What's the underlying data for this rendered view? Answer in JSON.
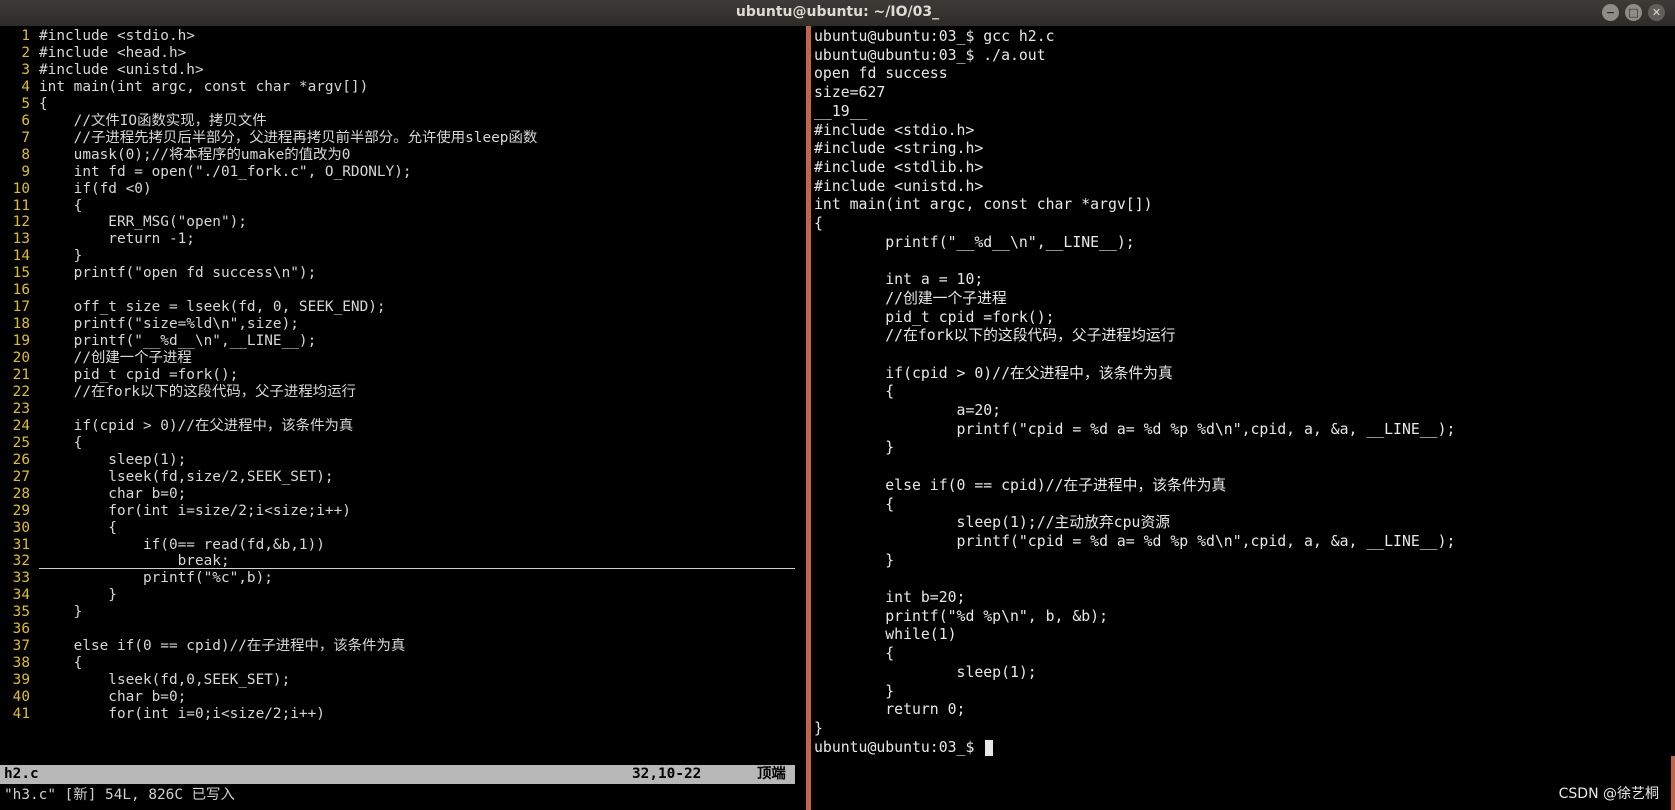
{
  "window": {
    "title": "ubuntu@ubuntu: ~/IO/03_",
    "buttons": [
      "−",
      "□",
      "✕"
    ]
  },
  "vim": {
    "lines": [
      "#include <stdio.h>",
      "#include <head.h>",
      "#include <unistd.h>",
      "int main(int argc, const char *argv[])",
      "{",
      "    //文件IO函数实现，拷贝文件",
      "    //子进程先拷贝后半部分，父进程再拷贝前半部分。允许使用sleep函数",
      "    umask(0);//将本程序的umake的值改为0",
      "    int fd = open(\"./01_fork.c\", O_RDONLY);",
      "    if(fd <0)",
      "    {",
      "        ERR_MSG(\"open\");",
      "        return -1;",
      "    }",
      "    printf(\"open fd success\\n\");",
      "",
      "    off_t size = lseek(fd, 0, SEEK_END);",
      "    printf(\"size=%ld\\n\",size);",
      "    printf(\"__%d__\\n\",__LINE__);",
      "    //创建一个子进程",
      "    pid_t cpid =fork();",
      "    //在fork以下的这段代码，父子进程均运行",
      "",
      "    if(cpid > 0)//在父进程中，该条件为真",
      "    {",
      "        sleep(1);",
      "        lseek(fd,size/2,SEEK_SET);",
      "        char b=0;",
      "        for(int i=size/2;i<size;i++)",
      "        {",
      "            if(0== read(fd,&b,1))",
      "                break;",
      "            printf(\"%c\",b);",
      "        }",
      "    }",
      "",
      "    else if(0 == cpid)//在子进程中，该条件为真",
      "    {",
      "        lseek(fd,0,SEEK_SET);",
      "        char b=0;",
      "        for(int i=0;i<size/2;i++)"
    ],
    "status": {
      "filename": "h2.c",
      "position": "32,10-22",
      "scroll": "顶端"
    },
    "cmdline": "\"h3.c\" [新] 54L, 826C 已写入"
  },
  "terminal": {
    "lines": [
      "ubuntu@ubuntu:03_$ gcc h2.c",
      "ubuntu@ubuntu:03_$ ./a.out",
      "open fd success",
      "size=627",
      "__19__",
      "#include <stdio.h>",
      "#include <string.h>",
      "#include <stdlib.h>",
      "#include <unistd.h>",
      "int main(int argc, const char *argv[])",
      "{",
      "        printf(\"__%d__\\n\",__LINE__);",
      "",
      "        int a = 10;",
      "        //创建一个子进程",
      "        pid_t cpid =fork();",
      "        //在fork以下的这段代码，父子进程均运行",
      "",
      "        if(cpid > 0)//在父进程中，该条件为真",
      "        {",
      "                a=20;",
      "                printf(\"cpid = %d a= %d %p %d\\n\",cpid, a, &a, __LINE__);",
      "        }",
      "",
      "        else if(0 == cpid)//在子进程中，该条件为真",
      "        {",
      "                sleep(1);//主动放弃cpu资源",
      "                printf(\"cpid = %d a= %d %p %d\\n\",cpid, a, &a, __LINE__);",
      "        }",
      "",
      "        int b=20;",
      "        printf(\"%d %p\\n\", b, &b);",
      "        while(1)",
      "        {",
      "                sleep(1);",
      "        }",
      "        return 0;",
      "}"
    ],
    "prompt": "ubuntu@ubuntu:03_$ "
  },
  "watermark": "CSDN @徐艺桐",
  "colors": {
    "line_number": "#e0c020",
    "divider": "#c36449",
    "statusline_bg": "#b8b8b8"
  }
}
